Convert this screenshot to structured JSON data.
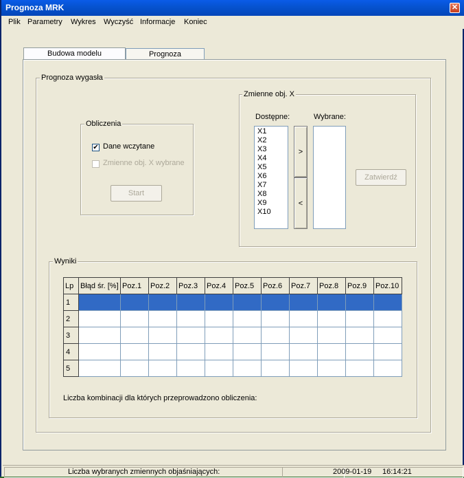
{
  "window": {
    "title": "Prognoza MRK",
    "close_glyph": "✕"
  },
  "menu": [
    "Plik",
    "Parametry",
    "Wykres",
    "Wyczyść",
    "Informacje",
    "Koniec"
  ],
  "tabs": [
    {
      "label": "Budowa modelu",
      "active": true
    },
    {
      "label": "Prognoza",
      "active": false
    }
  ],
  "main_group": {
    "label": "Prognoza wygasła"
  },
  "obliczenia": {
    "label": "Obliczenia",
    "check_loaded": {
      "label": "Dane wczytane",
      "checked": true,
      "enabled": true,
      "mark": "✔"
    },
    "check_vars": {
      "label": "Zmienne obj. X wybrane",
      "checked": false,
      "enabled": false
    },
    "start_button": "Start"
  },
  "zmienne": {
    "label": "Zmienne obj. X",
    "available_label": "Dostępne:",
    "selected_label": "Wybrane:",
    "available": [
      "X1",
      "X2",
      "X3",
      "X4",
      "X5",
      "X6",
      "X7",
      "X8",
      "X9",
      "X10"
    ],
    "selected": [],
    "add_button": ">",
    "remove_button": "<",
    "confirm_button": "Zatwierdź"
  },
  "wyniki": {
    "label": "Wyniki",
    "columns": [
      "Lp",
      "Błąd śr. [%]",
      "Poz.1",
      "Poz.2",
      "Poz.3",
      "Poz.4",
      "Poz.5",
      "Poz.6",
      "Poz.7",
      "Poz.8",
      "Poz.9",
      "Poz.10"
    ],
    "rows": [
      "1",
      "2",
      "3",
      "4",
      "5"
    ],
    "selected_row": 1,
    "combinations_label": "Liczba kombinacji dla których przeprowadzono obliczenia:"
  },
  "status": {
    "vars_label": "Liczba wybranych zmiennych objaśniających:",
    "date": "2009-01-19",
    "time": "16:14:21"
  },
  "colors": {
    "selection": "#316ac5",
    "titlebar": "#0653d1"
  }
}
